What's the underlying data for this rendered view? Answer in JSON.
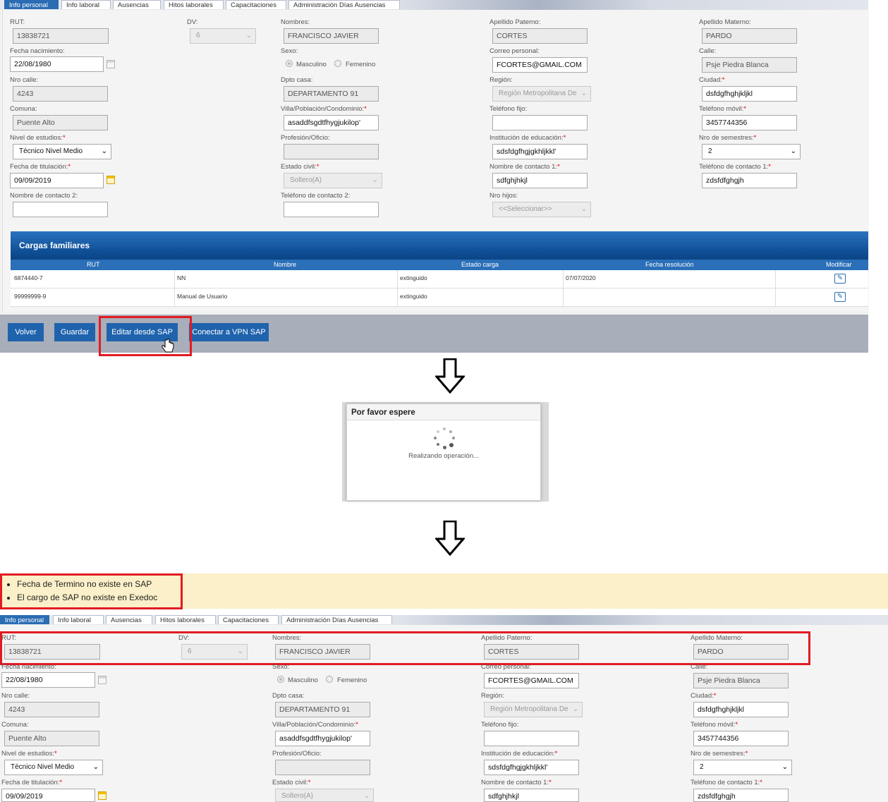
{
  "tabs": [
    "Info personal",
    "Info laboral",
    "Ausencias",
    "Hitos laborales",
    "Capacitaciones",
    "Administración Días Ausencias"
  ],
  "form": {
    "rut": {
      "label": "RUT:",
      "value": "13838721"
    },
    "dv": {
      "label": "DV:",
      "value": "6"
    },
    "nombres": {
      "label": "Nombres:",
      "value": "FRANCISCO JAVIER"
    },
    "apellido_paterno": {
      "label": "Apellido Paterno:",
      "value": "CORTES"
    },
    "apellido_materno": {
      "label": "Apellido Materno:",
      "value": "PARDO"
    },
    "fecha_nacimiento": {
      "label": "Fecha nacimiento:",
      "value": "22/08/1980"
    },
    "sexo": {
      "label": "Sexo:",
      "opt1": "Masculino",
      "opt2": "Femenino",
      "selected": "Masculino"
    },
    "correo": {
      "label": "Correo personal:",
      "value": "FCORTES@GMAIL.COM"
    },
    "calle": {
      "label": "Calle:",
      "value": "Psje Piedra Blanca"
    },
    "nro_calle": {
      "label": "Nro calle:",
      "value": "4243"
    },
    "dpto": {
      "label": "Dpto casa:",
      "value": "DEPARTAMENTO 91"
    },
    "region": {
      "label": "Región:",
      "value": "Región Metropolitana De"
    },
    "ciudad": {
      "label": "Ciudad:",
      "value": "dsfdgfhghjkljkl"
    },
    "comuna": {
      "label": "Comuna:",
      "value": "Puente Alto"
    },
    "villa": {
      "label": "Villa/Población/Condominio:",
      "value": "asaddfsgdtfhygjukilop'"
    },
    "telefono_fijo": {
      "label": "Teléfono fijo:",
      "value": ""
    },
    "telefono_movil": {
      "label": "Teléfono móvil:",
      "value": "3457744356"
    },
    "nivel_estudios": {
      "label": "Nivel de estudios:",
      "value": "Técnico Nivel Medio"
    },
    "profesion": {
      "label": "Profesión/Oficio:",
      "value": ""
    },
    "institucion": {
      "label": "Institución de educación:",
      "value": "sdsfdgfhgjgkhljkkl'"
    },
    "nro_semestres": {
      "label": "Nro de semestres:",
      "value": "2"
    },
    "fecha_titulacion": {
      "label": "Fecha de titulación:",
      "value": "09/09/2019"
    },
    "estado_civil": {
      "label": "Estado civil:",
      "value": "Soltero(A)"
    },
    "nombre_contacto_1": {
      "label": "Nombre de contacto 1:",
      "value": "sdfghjhkjl"
    },
    "telefono_contacto_1": {
      "label": "Teléfono de contacto 1:",
      "value": "zdsfdfghgjh"
    },
    "nombre_contacto_2": {
      "label": "Nombre de contacto 2:",
      "value": ""
    },
    "telefono_contacto_2": {
      "label": "Teléfono de contacto 2:",
      "value": ""
    },
    "nro_hijos": {
      "label": "Nro hijos:",
      "value": "<<Seleccionar>>"
    }
  },
  "cargas": {
    "title": "Cargas familiares",
    "columns": [
      "RUT",
      "Nombre",
      "Estado carga",
      "Fecha resolución",
      "Modificar"
    ],
    "rows": [
      {
        "rut": "6874440-7",
        "nombre": "NN",
        "estado": "extinguido",
        "fecha": "07/07/2020"
      },
      {
        "rut": "99999999-9",
        "nombre": "Manual de Usuario",
        "estado": "extinguido",
        "fecha": ""
      }
    ]
  },
  "buttons": {
    "volver": "Volver",
    "guardar": "Guardar",
    "editar_sap": "Editar desde SAP",
    "conectar_vpn": "Conectar a VPN SAP"
  },
  "dialog": {
    "title": "Por favor espere",
    "message": "Realizando operación..."
  },
  "messages": [
    "Fecha de Termino no existe en SAP",
    "El cargo de SAP no existe en Exedoc"
  ],
  "colors": {
    "primary": "#1f63ad",
    "highlight": "#e21b22",
    "message_bg": "#fbf0c9"
  }
}
